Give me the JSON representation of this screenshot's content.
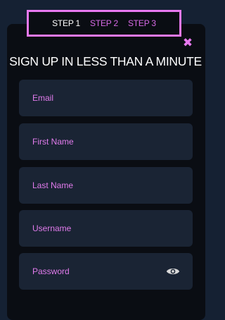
{
  "steps": {
    "step1": "STEP 1",
    "step2": "STEP 2",
    "step3": "STEP 3"
  },
  "close_glyph": "✖",
  "title": "SIGN UP IN LESS THAN A MINUTE",
  "fields": {
    "email": "Email",
    "first_name": "First Name",
    "last_name": "Last Name",
    "username": "Username",
    "password": "Password"
  },
  "icons": {
    "close": "close-icon",
    "password_toggle": "eye-icon"
  },
  "colors": {
    "accent": "#e879f0",
    "field_bg": "#1a2434",
    "modal_bg": "#0a0d13",
    "page_bg": "#152133"
  }
}
